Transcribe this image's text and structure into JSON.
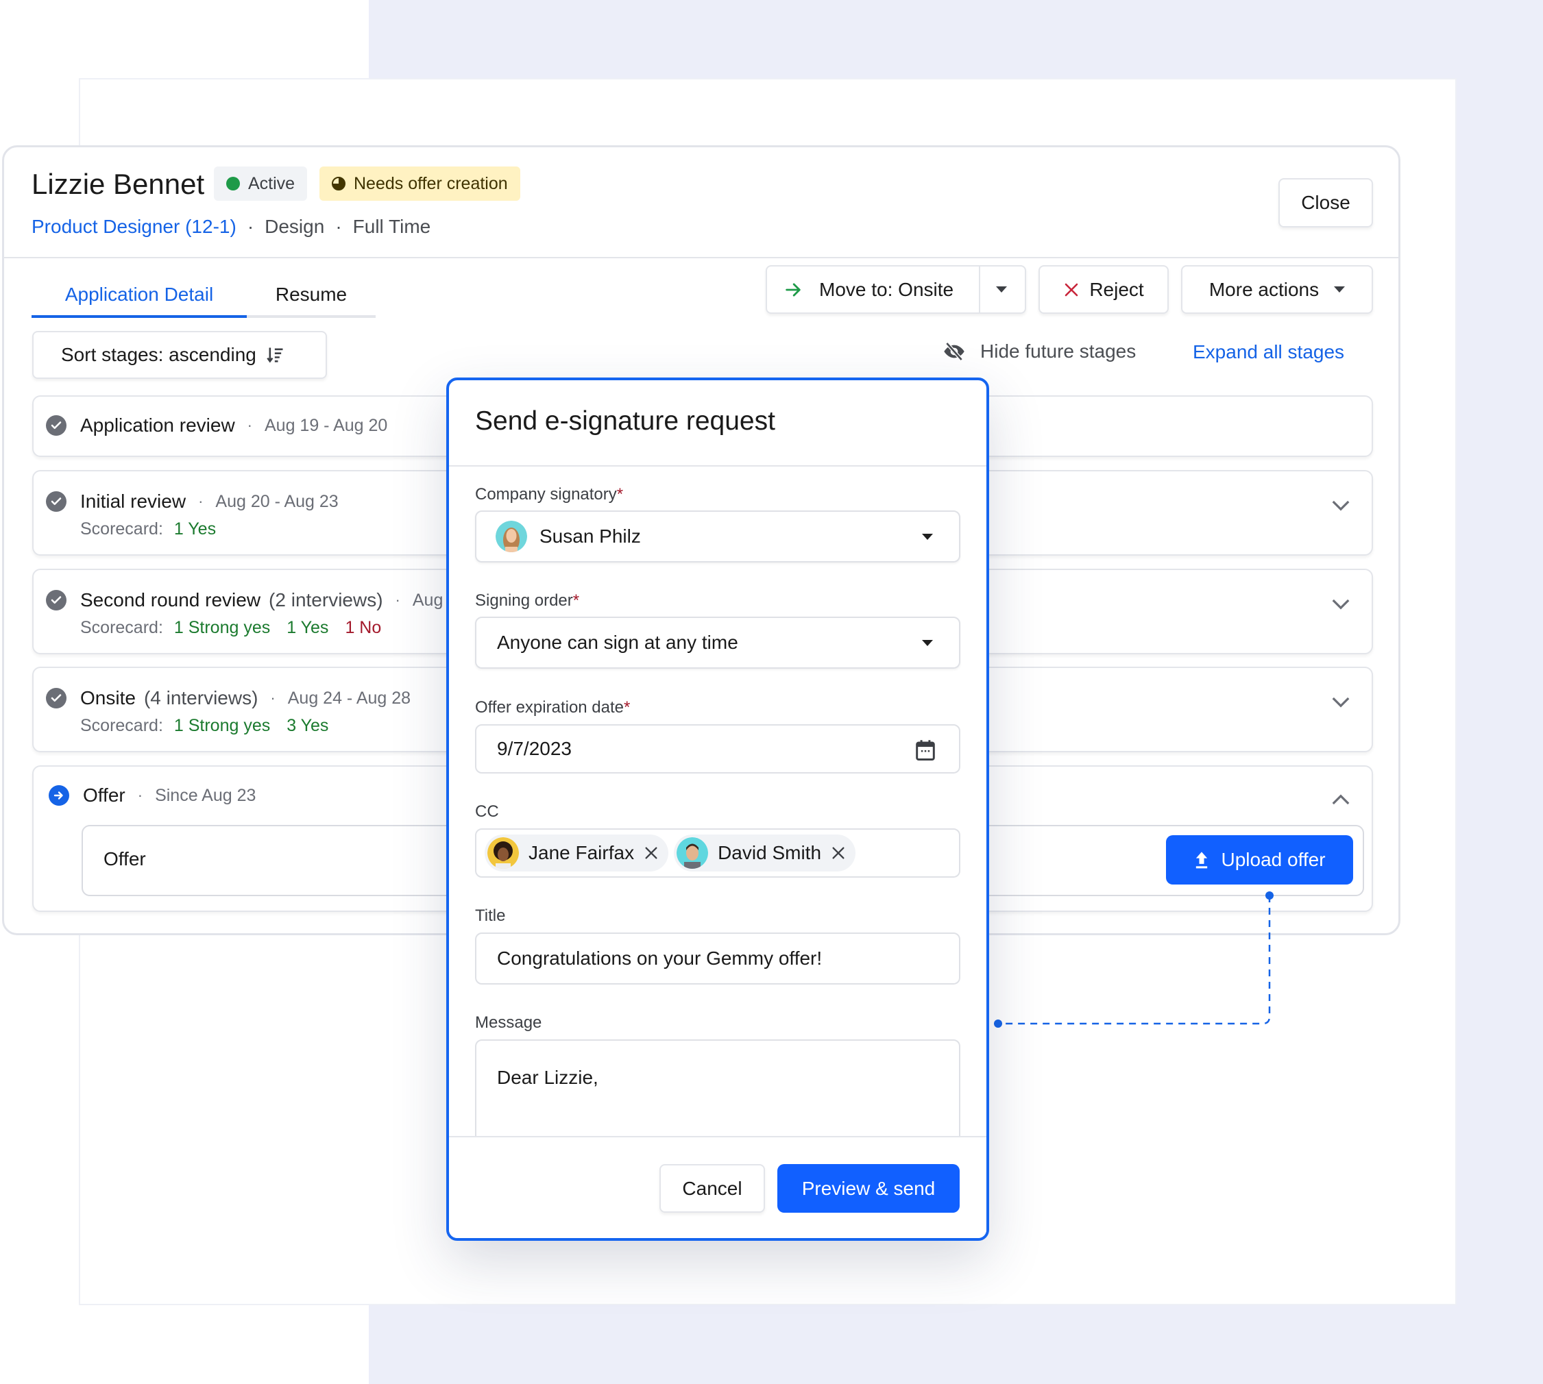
{
  "candidate": {
    "name": "Lizzie Bennet",
    "status_badge": "Active",
    "status_color": "#1e9a48",
    "alert_badge": "Needs offer creation",
    "job_link": "Product Designer (12-1)",
    "department": "Design",
    "employment_type": "Full Time",
    "separator": "·"
  },
  "header": {
    "close_label": "Close"
  },
  "tabs": [
    {
      "label": "Application Detail",
      "active": true
    },
    {
      "label": "Resume",
      "active": false
    }
  ],
  "actions": {
    "move_label": "Move to: Onsite",
    "reject_label": "Reject",
    "more_label": "More actions"
  },
  "toolbar": {
    "sort_label": "Sort stages: ascending",
    "hide_label": "Hide future stages",
    "expand_label": "Expand all stages"
  },
  "stages": [
    {
      "name": "Application review",
      "count": "",
      "date": "Aug 19 - Aug 20",
      "status": "complete",
      "scorecard": []
    },
    {
      "name": "Initial review",
      "count": "",
      "date": "Aug 20 - Aug 23",
      "status": "complete",
      "scorecard_label": "Scorecard:",
      "scorecard": [
        {
          "text": "1 Yes",
          "tone": "positive"
        }
      ]
    },
    {
      "name": "Second round review",
      "count": "(2 interviews)",
      "date": "Aug",
      "status": "complete",
      "scorecard_label": "Scorecard:",
      "scorecard": [
        {
          "text": "1 Strong yes",
          "tone": "positive"
        },
        {
          "text": "1 Yes",
          "tone": "positive"
        },
        {
          "text": "1 No",
          "tone": "negative"
        }
      ]
    },
    {
      "name": "Onsite",
      "count": "(4 interviews)",
      "date": "Aug 24 - Aug 28",
      "status": "complete",
      "scorecard_label": "Scorecard:",
      "scorecard": [
        {
          "text": "1 Strong yes",
          "tone": "positive"
        },
        {
          "text": "3 Yes",
          "tone": "positive"
        }
      ]
    },
    {
      "name": "Offer",
      "count": "",
      "date": "Since Aug 23",
      "status": "current",
      "inner_label": "Offer",
      "upload_label": "Upload offer"
    }
  ],
  "modal": {
    "title": "Send e-signature request",
    "required_mark": "*",
    "fields": {
      "signatory": {
        "label": "Company signatory",
        "value": "Susan Philz"
      },
      "signing_order": {
        "label": "Signing order",
        "value": "Anyone can sign at any time"
      },
      "expiration": {
        "label": "Offer expiration date",
        "value": "9/7/2023"
      },
      "cc": {
        "label": "CC",
        "chips": [
          "Jane Fairfax",
          "David Smith"
        ]
      },
      "title": {
        "label": "Title",
        "value": "Congratulations on your Gemmy offer!"
      },
      "message": {
        "label": "Message",
        "value": "Dear Lizzie,"
      }
    },
    "cancel_label": "Cancel",
    "submit_label": "Preview & send"
  },
  "colors": {
    "accent": "#1160ff",
    "link": "#1563e6",
    "positive": "#1b7a2e",
    "negative": "#a3192b",
    "background": "#ECEEF9"
  }
}
